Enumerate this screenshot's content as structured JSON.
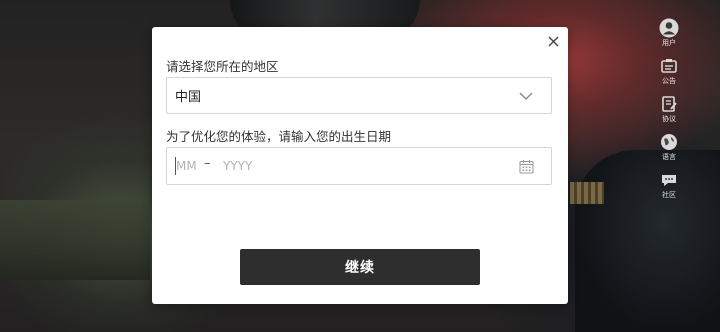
{
  "dialog": {
    "region_label": "请选择您所在的地区",
    "region_value": "中国",
    "birth_label": "为了优化您的体验，请输入您的出生日期",
    "month_placeholder": "MM",
    "year_placeholder": "YYYY",
    "separator": "–",
    "continue_label": "继续"
  },
  "sidebar": {
    "items": [
      {
        "label": "用户",
        "icon": "user-icon"
      },
      {
        "label": "公告",
        "icon": "announcement-icon"
      },
      {
        "label": "协议",
        "icon": "agreement-icon"
      },
      {
        "label": "语言",
        "icon": "globe-icon"
      },
      {
        "label": "社区",
        "icon": "community-icon"
      }
    ]
  },
  "colors": {
    "button_bg": "#2e2e2e",
    "dialog_bg": "#ffffff",
    "border": "#d5d5d5"
  }
}
